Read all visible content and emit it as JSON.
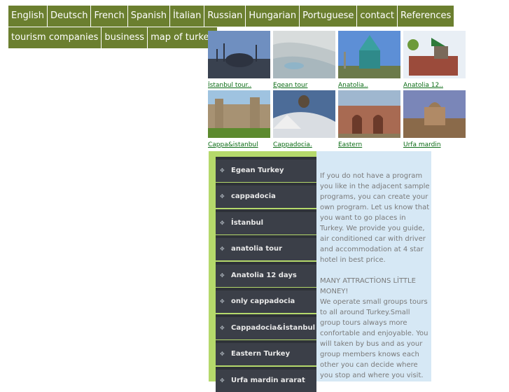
{
  "nav": {
    "row1": [
      "English",
      "Deutsch",
      "French",
      "Spanish",
      "İtalian",
      "Russian",
      "Hungarian",
      "Portuguese",
      "contact",
      "References"
    ],
    "row2": [
      "tourism companies",
      "business",
      "map of turkey"
    ]
  },
  "thumbnails": [
    {
      "caption": "İstanbul tour.."
    },
    {
      "caption": "Egean tour"
    },
    {
      "caption": "Anatolia.."
    },
    {
      "caption": "Anatolia 12.."
    },
    {
      "caption": "Cappa&istanbul"
    },
    {
      "caption": "Cappadocia."
    },
    {
      "caption": "Eastern"
    },
    {
      "caption": "Urfa mardin"
    }
  ],
  "menu": [
    "Egean Turkey",
    "cappadocia",
    "İstanbul",
    "anatolia tour",
    "Anatolia 12 days",
    "only cappadocia",
    "Cappadocia&İstanbul",
    "Eastern Turkey",
    "Urfa mardin ararat"
  ],
  "body": {
    "p1": "If you do not have a program you like in the adjacent sample programs, you can create your own program. Let us know that you want to go places in Turkey. We provide you guide, air conditioned car with driver and accommodation at 4 star hotel in best price.",
    "p2": "MANY ATTRACTİONS LİTTLE MONEY!",
    "p3": "We operate small groups tours to all around Turkey.Small group tours always more confortable and enjoyable. You will taken by bus and as your group members knows each other you can decide where you stop and where you visit."
  }
}
